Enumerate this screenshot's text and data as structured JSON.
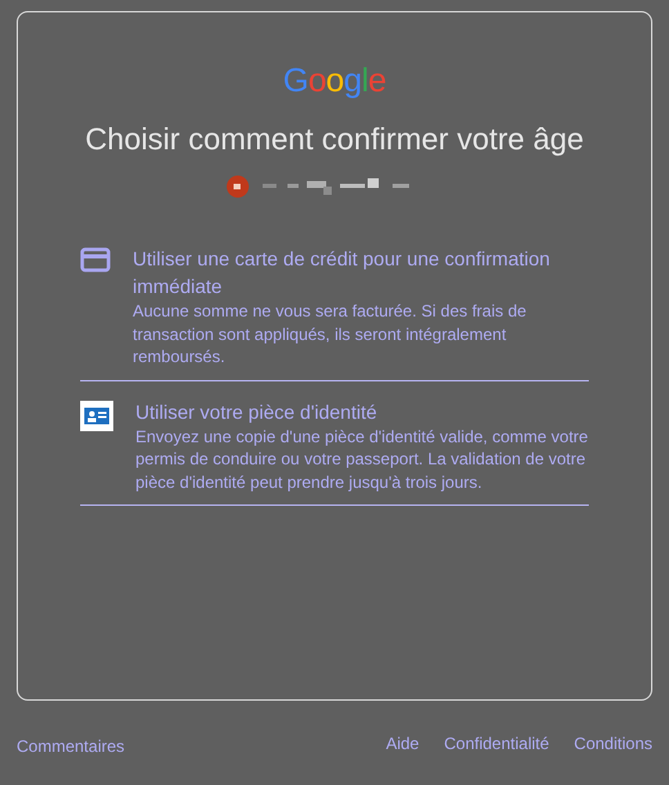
{
  "logo": "Google",
  "title": "Choisir comment confirmer votre âge",
  "options": [
    {
      "kind": "card",
      "title": "Utiliser une carte de crédit pour une confirmation immédiate",
      "description": "Aucune somme ne vous sera facturée. Si des frais de transaction sont appliqués, ils seront intégralement remboursés."
    },
    {
      "kind": "id",
      "title": "Utiliser votre pièce d'identité",
      "description": "Envoyez une copie d'une pièce d'identité valide, comme votre permis de conduire ou votre passeport. La validation de votre pièce d'identité peut prendre jusqu'à trois jours."
    }
  ],
  "footer": {
    "left": [
      "Commentaires"
    ],
    "right": [
      "Aide",
      "Confidentialité",
      "Conditions"
    ]
  }
}
